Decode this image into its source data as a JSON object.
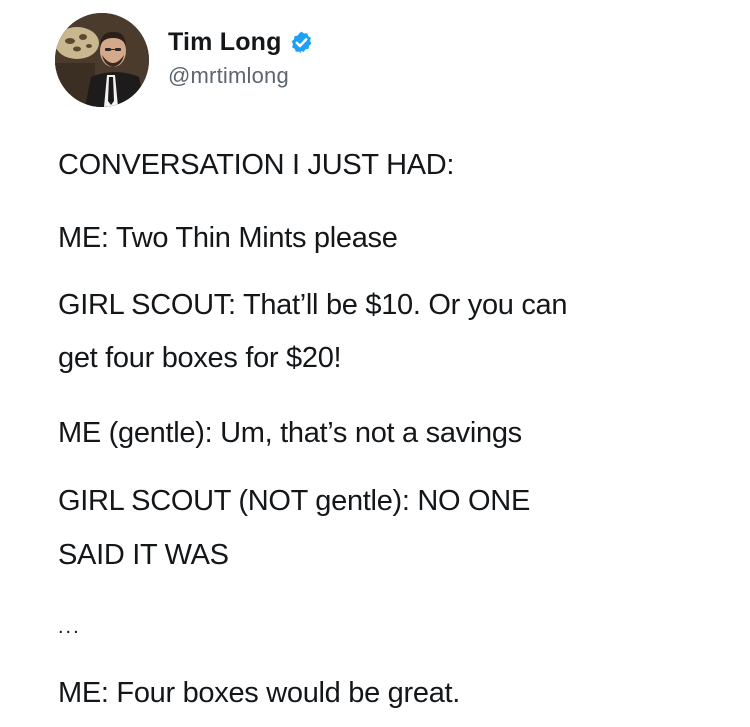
{
  "author": {
    "display_name": "Tim Long",
    "handle": "@mrtimlong",
    "avatar_icon": "profile-photo",
    "verified_icon": "verified-badge-icon",
    "verified_color": "#1da1f2"
  },
  "tweet": {
    "lines": [
      "CONVERSATION I JUST HAD:",
      "ME: Two Thin Mints please",
      "GIRL SCOUT: That’ll be $10. Or you can",
      "get four boxes for $20!",
      "ME (gentle): Um, that’s not a savings",
      "GIRL SCOUT (NOT gentle): NO ONE",
      "SAID IT WAS",
      "...",
      "ME: Four boxes would be great."
    ]
  }
}
